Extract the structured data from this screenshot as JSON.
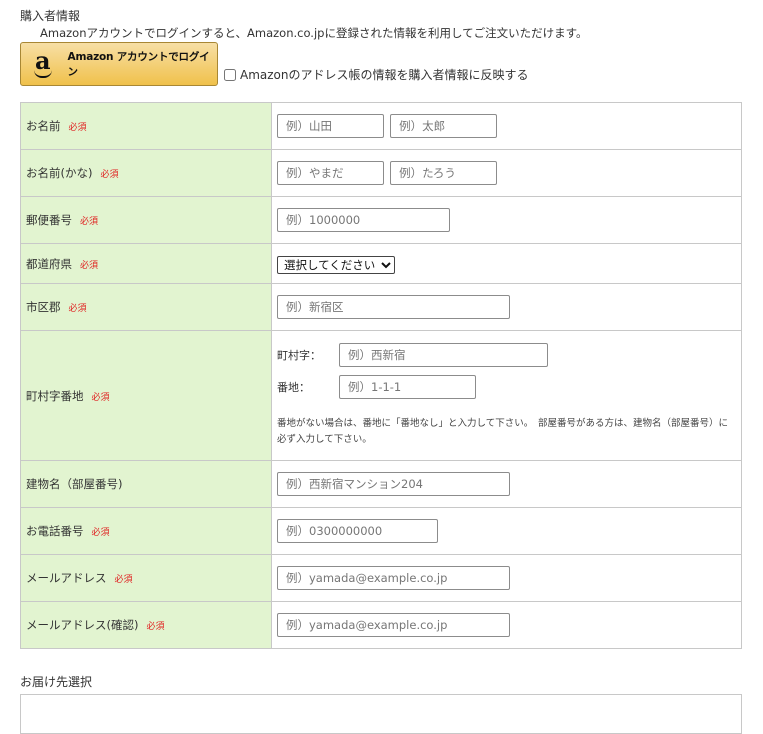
{
  "purchaser_title": "購入者情報",
  "amazon_notice": "Amazonアカウントでログインすると、Amazon.co.jpに登録された情報を利用してご注文いただけます。",
  "amazon_button_label": "Amazon アカウントでログイン",
  "amazon_button_logo": "a",
  "reflect_label": "Amazonのアドレス帳の情報を購入者情報に反映する",
  "required_text": "必須",
  "rows": {
    "name": {
      "label": "お名前",
      "ph_last": "例）山田",
      "ph_first": "例）太郎"
    },
    "kana": {
      "label": "お名前(かな)",
      "ph_last": "例）やまだ",
      "ph_first": "例）たろう"
    },
    "zip": {
      "label": "郵便番号",
      "ph": "例）1000000"
    },
    "prefecture": {
      "label": "都道府県",
      "selected": "選択してください"
    },
    "city": {
      "label": "市区郡",
      "ph": "例）新宿区"
    },
    "address": {
      "label": "町村字番地",
      "town_label": "町村字：",
      "town_ph": "例）西新宿",
      "number_label": "番地：",
      "number_ph": "例）1-1-1",
      "hint": "番地がない場合は、番地に「番地なし」と入力して下さい。　部屋番号がある方は、建物名（部屋番号）に必ず入力して下さい。"
    },
    "building": {
      "label": "建物名（部屋番号)",
      "ph": "例）西新宿マンション204"
    },
    "phone": {
      "label": "お電話番号",
      "ph": "例）0300000000"
    },
    "email": {
      "label": "メールアドレス",
      "ph": "例）yamada@example.co.jp"
    },
    "email_confirm": {
      "label": "メールアドレス(確認)",
      "ph": "例）yamada@example.co.jp"
    }
  },
  "delivery_title": "お届け先選択",
  "colors": {
    "label_bg": "#e2f4d0",
    "required": "#e02020",
    "amazon_button": "#f0c14b"
  }
}
